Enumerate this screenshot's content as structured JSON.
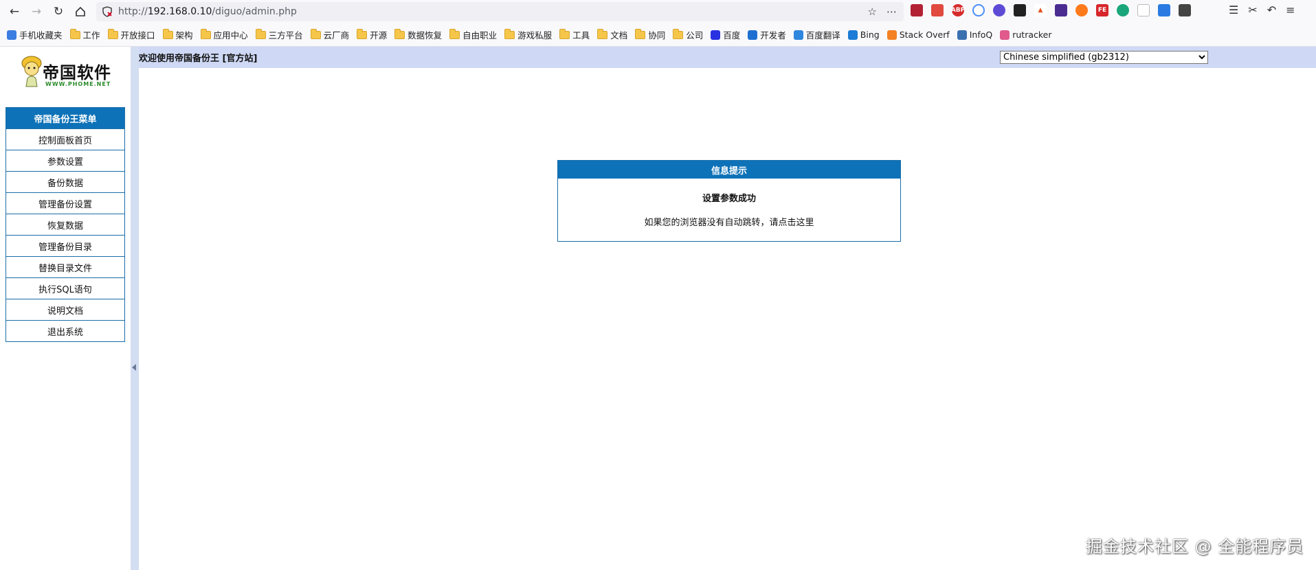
{
  "browser": {
    "url_prefix": "http://",
    "url_host": "192.168.0.10",
    "url_path": "/diguo/admin.php"
  },
  "bookmarks": [
    {
      "label": "手机收藏夹",
      "kind": "mobile"
    },
    {
      "label": "工作",
      "kind": "folder"
    },
    {
      "label": "开放接口",
      "kind": "folder"
    },
    {
      "label": "架构",
      "kind": "folder"
    },
    {
      "label": "应用中心",
      "kind": "folder"
    },
    {
      "label": "三方平台",
      "kind": "folder"
    },
    {
      "label": "云厂商",
      "kind": "folder"
    },
    {
      "label": "开源",
      "kind": "folder"
    },
    {
      "label": "数据恢复",
      "kind": "folder"
    },
    {
      "label": "自由职业",
      "kind": "folder"
    },
    {
      "label": "游戏私服",
      "kind": "folder"
    },
    {
      "label": "工具",
      "kind": "folder"
    },
    {
      "label": "文档",
      "kind": "folder"
    },
    {
      "label": "协同",
      "kind": "folder"
    },
    {
      "label": "公司",
      "kind": "folder"
    },
    {
      "label": "百度",
      "kind": "baidu"
    },
    {
      "label": "开发者",
      "kind": "dev"
    },
    {
      "label": "百度翻译",
      "kind": "translate"
    },
    {
      "label": "Bing",
      "kind": "bing"
    },
    {
      "label": "Stack Overf",
      "kind": "stack"
    },
    {
      "label": "InfoQ",
      "kind": "infoq"
    },
    {
      "label": "rutracker",
      "kind": "rutracker"
    }
  ],
  "logo": {
    "name": "帝国软件",
    "site": "WWW.PHOME.NET"
  },
  "menu": {
    "title": "帝国备份王菜单",
    "items": [
      "控制面板首页",
      "参数设置",
      "备份数据",
      "管理备份设置",
      "恢复数据",
      "管理备份目录",
      "替换目录文件",
      "执行SQL语句",
      "说明文档",
      "退出系统"
    ]
  },
  "header": {
    "welcome": "欢迎使用帝国备份王 [官方站]",
    "language": "Chinese simplified (gb2312)"
  },
  "message": {
    "title": "信息提示",
    "main": "设置参数成功",
    "redirect": "如果您的浏览器没有自动跳转，请点击这里"
  },
  "watermark": "掘金技术社区 @ 全能程序员"
}
